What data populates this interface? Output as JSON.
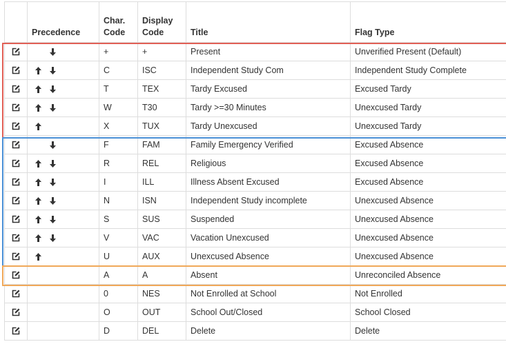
{
  "table": {
    "headers": {
      "precedence": "Precedence",
      "char_code": [
        "Char.",
        "Code"
      ],
      "display_code": [
        "Display",
        "Code"
      ],
      "title": "Title",
      "flag_type": "Flag Type"
    },
    "rows": [
      {
        "up": false,
        "down": true,
        "char": "+",
        "display": "+",
        "title": "Present",
        "flag": "Unverified Present (Default)"
      },
      {
        "up": true,
        "down": true,
        "char": "C",
        "display": "ISC",
        "title": "Independent Study Com",
        "flag": "Independent Study Complete"
      },
      {
        "up": true,
        "down": true,
        "char": "T",
        "display": "TEX",
        "title": "Tardy Excused",
        "flag": "Excused Tardy"
      },
      {
        "up": true,
        "down": true,
        "char": "W",
        "display": "T30",
        "title": "Tardy >=30 Minutes",
        "flag": "Unexcused Tardy"
      },
      {
        "up": true,
        "down": false,
        "char": "X",
        "display": "TUX",
        "title": "Tardy Unexcused",
        "flag": "Unexcused Tardy"
      },
      {
        "up": false,
        "down": true,
        "char": "F",
        "display": "FAM",
        "title": "Family Emergency Verified",
        "flag": "Excused Absence"
      },
      {
        "up": true,
        "down": true,
        "char": "R",
        "display": "REL",
        "title": "Religious",
        "flag": "Excused Absence"
      },
      {
        "up": true,
        "down": true,
        "char": "I",
        "display": "ILL",
        "title": "Illness Absent Excused",
        "flag": "Excused Absence"
      },
      {
        "up": true,
        "down": true,
        "char": "N",
        "display": "ISN",
        "title": "Independent Study incomplete",
        "flag": "Unexcused Absence"
      },
      {
        "up": true,
        "down": true,
        "char": "S",
        "display": "SUS",
        "title": "Suspended",
        "flag": "Unexcused Absence"
      },
      {
        "up": true,
        "down": true,
        "char": "V",
        "display": "VAC",
        "title": "Vacation Unexcused",
        "flag": "Unexcused Absence"
      },
      {
        "up": true,
        "down": false,
        "char": "U",
        "display": "AUX",
        "title": "Unexcused Absence",
        "flag": "Unexcused Absence"
      },
      {
        "up": false,
        "down": false,
        "char": "A",
        "display": "A",
        "title": "Absent",
        "flag": "Unreconciled Absence"
      },
      {
        "up": false,
        "down": false,
        "char": "0",
        "display": "NES",
        "title": "Not Enrolled at School",
        "flag": "Not Enrolled"
      },
      {
        "up": false,
        "down": false,
        "char": "O",
        "display": "OUT",
        "title": "School Out/Closed",
        "flag": "School Closed"
      },
      {
        "up": false,
        "down": false,
        "char": "D",
        "display": "DEL",
        "title": "Delete",
        "flag": "Delete"
      }
    ]
  },
  "icons": {
    "edit": "edit-icon",
    "up": "arrow-up-icon",
    "down": "arrow-down-icon"
  },
  "groups": [
    {
      "name": "present-tardy-group",
      "color": "#e15f55"
    },
    {
      "name": "absence-group",
      "color": "#4a90d6"
    },
    {
      "name": "unreconciled-group",
      "color": "#f0a858"
    }
  ]
}
